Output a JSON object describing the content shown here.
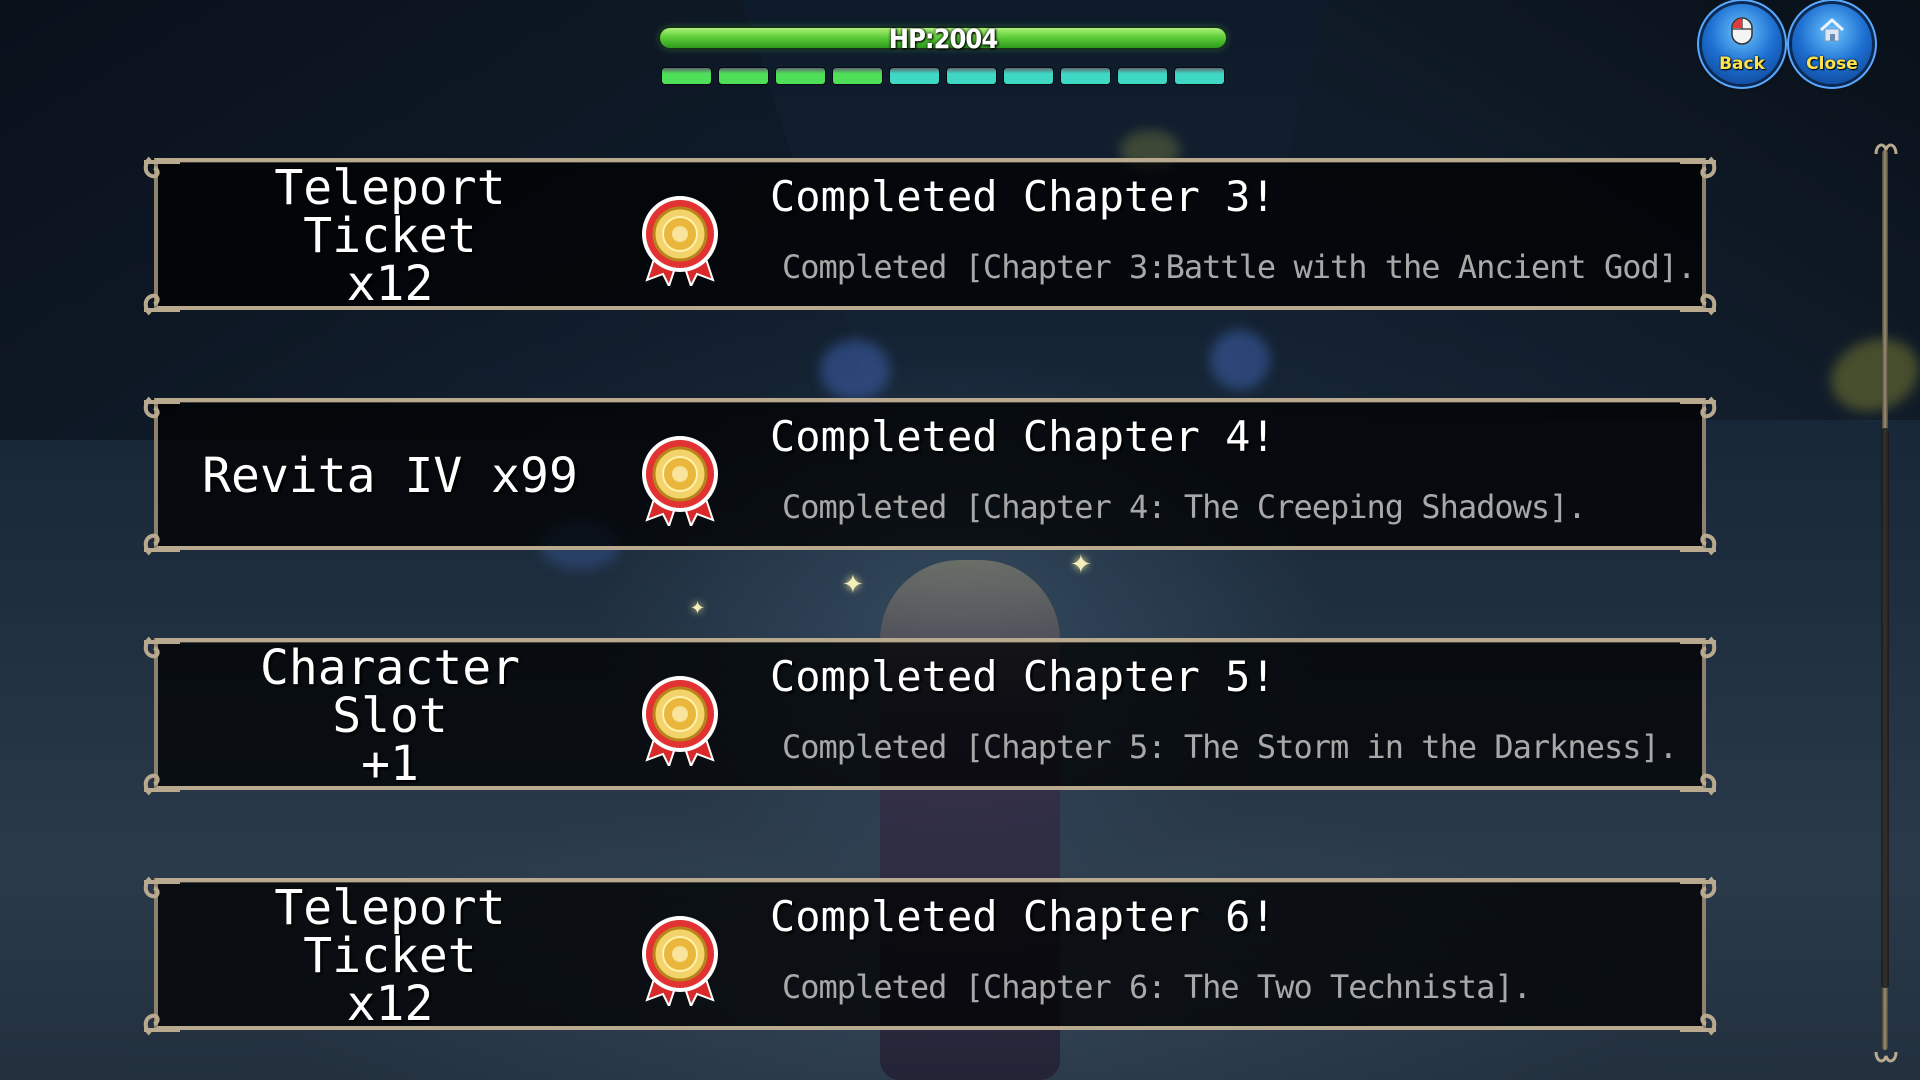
{
  "hud": {
    "hp_label": "HP:2004",
    "hp_fraction": 1.0,
    "segments": [
      {
        "color": "#4fe05a"
      },
      {
        "color": "#4fe05a"
      },
      {
        "color": "#4fe05a"
      },
      {
        "color": "#4fe05a"
      },
      {
        "color": "#3fd8c4"
      },
      {
        "color": "#3fd8c4"
      },
      {
        "color": "#3fd8c4"
      },
      {
        "color": "#3fd8c4"
      },
      {
        "color": "#3fd8c4"
      },
      {
        "color": "#3fd8c4"
      }
    ]
  },
  "buttons": {
    "back_label": "Back",
    "close_label": "Close"
  },
  "quests": [
    {
      "reward": "Teleport Ticket\nx12",
      "title": "Completed Chapter 3!",
      "description": "Completed [Chapter 3:Battle with the Ancient God].",
      "icon": "medal-icon"
    },
    {
      "reward": "Revita IV x99",
      "title": "Completed Chapter 4!",
      "description": "Completed [Chapter 4: The Creeping Shadows].",
      "icon": "medal-icon"
    },
    {
      "reward": "Character Slot\n+1",
      "title": "Completed Chapter 5!",
      "description": "Completed [Chapter 5: The Storm in the Darkness].",
      "icon": "medal-icon"
    },
    {
      "reward": "Teleport Ticket\nx12",
      "title": "Completed Chapter 6!",
      "description": "Completed [Chapter 6: The Two Technista].",
      "icon": "medal-icon"
    }
  ],
  "colors": {
    "panel_border": "#b9aa8f",
    "title_text": "#ffffff",
    "desc_text": "#a8a8a8",
    "button_label": "#ffe34a",
    "hp_green": "#5fcf3a"
  }
}
